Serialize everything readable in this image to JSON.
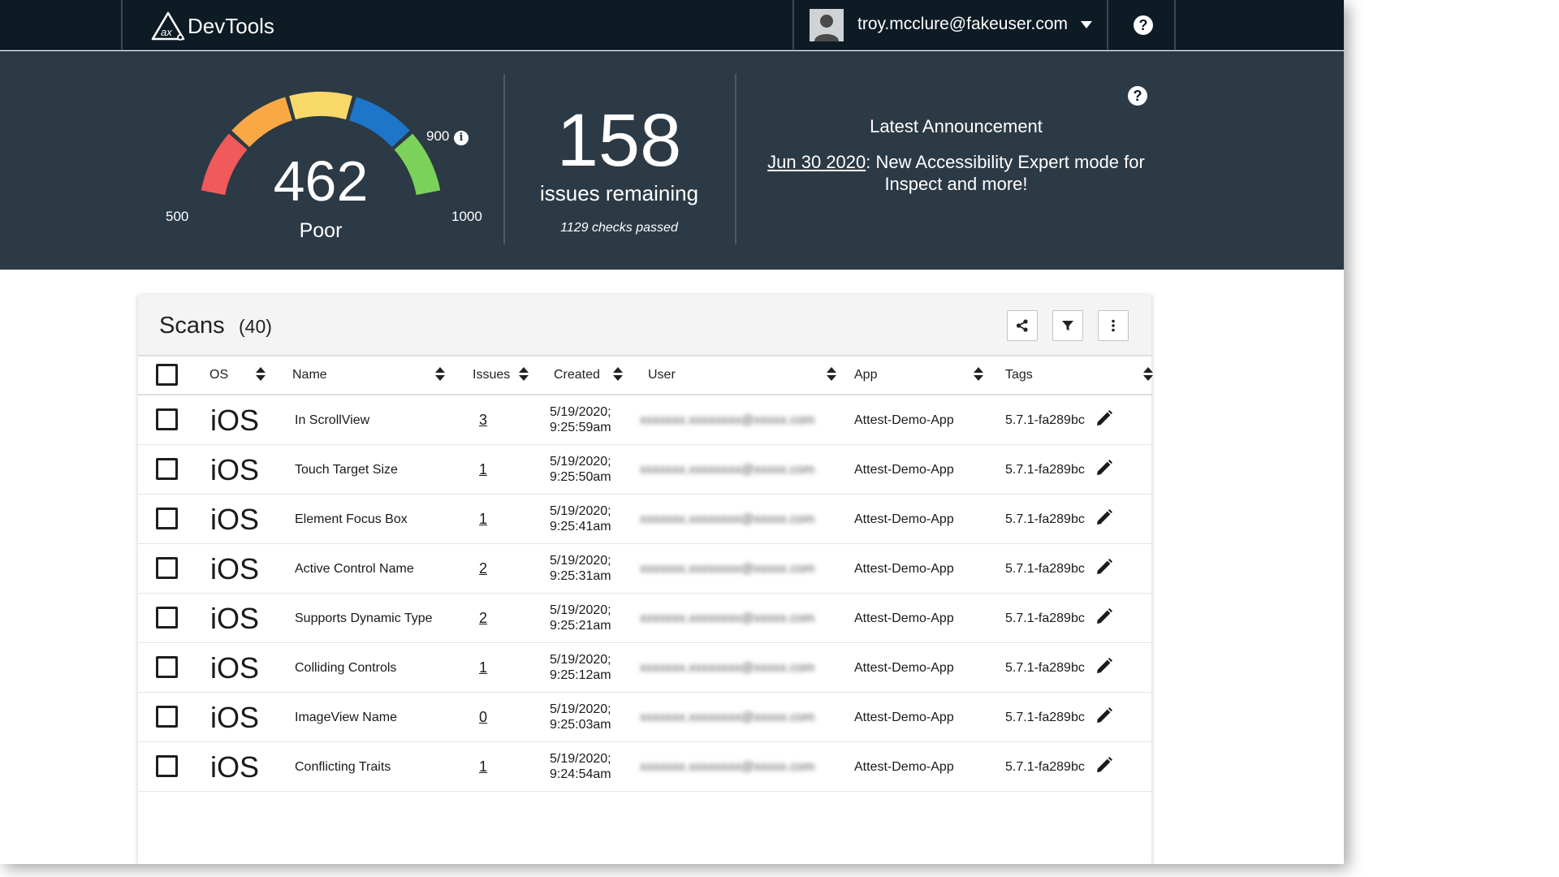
{
  "header": {
    "brand": "DevTools",
    "user_email": "troy.mcclure@fakeuser.com"
  },
  "summary": {
    "gauge": {
      "score": "462",
      "rating": "Poor",
      "min_label": "500",
      "mid_label": "900",
      "max_label": "1000",
      "segment_colors": [
        "#f05a5b",
        "#f8a844",
        "#f9d86a",
        "#1d76c9",
        "#7cd15a"
      ]
    },
    "issues": {
      "count": "158",
      "label": "issues remaining",
      "checks_passed": "1129 checks passed"
    },
    "announcement": {
      "title": "Latest Announcement",
      "date": "Jun 30 2020",
      "text": ": New Accessibility Expert mode for Inspect and more!"
    }
  },
  "scans": {
    "title": "Scans",
    "count": "(40)",
    "columns": [
      "OS",
      "Name",
      "Issues",
      "Created",
      "User",
      "App",
      "Tags"
    ],
    "rows": [
      {
        "os": "iOS",
        "name": "In ScrollView",
        "issues": "3",
        "created_date": "5/19/2020;",
        "created_time": "9:25:59am",
        "user": "xxxxxxx.xxxxxxxx@xxxxx.com",
        "app": "Attest-Demo-App",
        "tag": "5.7.1-fa289bc"
      },
      {
        "os": "iOS",
        "name": "Touch Target Size",
        "issues": "1",
        "created_date": "5/19/2020;",
        "created_time": "9:25:50am",
        "user": "xxxxxxx.xxxxxxxx@xxxxx.com",
        "app": "Attest-Demo-App",
        "tag": "5.7.1-fa289bc"
      },
      {
        "os": "iOS",
        "name": "Element Focus Box",
        "issues": "1",
        "created_date": "5/19/2020;",
        "created_time": "9:25:41am",
        "user": "xxxxxxx.xxxxxxxx@xxxxx.com",
        "app": "Attest-Demo-App",
        "tag": "5.7.1-fa289bc"
      },
      {
        "os": "iOS",
        "name": "Active Control Name",
        "issues": "2",
        "created_date": "5/19/2020;",
        "created_time": "9:25:31am",
        "user": "xxxxxxx.xxxxxxxx@xxxxx.com",
        "app": "Attest-Demo-App",
        "tag": "5.7.1-fa289bc"
      },
      {
        "os": "iOS",
        "name": "Supports Dynamic Type",
        "issues": "2",
        "created_date": "5/19/2020;",
        "created_time": "9:25:21am",
        "user": "xxxxxxx.xxxxxxxx@xxxxx.com",
        "app": "Attest-Demo-App",
        "tag": "5.7.1-fa289bc"
      },
      {
        "os": "iOS",
        "name": "Colliding Controls",
        "issues": "1",
        "created_date": "5/19/2020;",
        "created_time": "9:25:12am",
        "user": "xxxxxxx.xxxxxxxx@xxxxx.com",
        "app": "Attest-Demo-App",
        "tag": "5.7.1-fa289bc"
      },
      {
        "os": "iOS",
        "name": "ImageView Name",
        "issues": "0",
        "created_date": "5/19/2020;",
        "created_time": "9:25:03am",
        "user": "xxxxxxx.xxxxxxxx@xxxxx.com",
        "app": "Attest-Demo-App",
        "tag": "5.7.1-fa289bc"
      },
      {
        "os": "iOS",
        "name": "Conflicting Traits",
        "issues": "1",
        "created_date": "5/19/2020;",
        "created_time": "9:24:54am",
        "user": "xxxxxxx.xxxxxxxx@xxxxx.com",
        "app": "Attest-Demo-App",
        "tag": "5.7.1-fa289bc"
      }
    ]
  },
  "icons": {
    "logo": "axe-logo-icon",
    "avatar": "user-avatar-icon",
    "dropdown": "chevron-down-icon",
    "help": "help-icon",
    "info": "info-icon",
    "share": "share-icon",
    "filter": "filter-icon",
    "more": "more-vert-icon",
    "edit": "edit-pencil-icon"
  }
}
